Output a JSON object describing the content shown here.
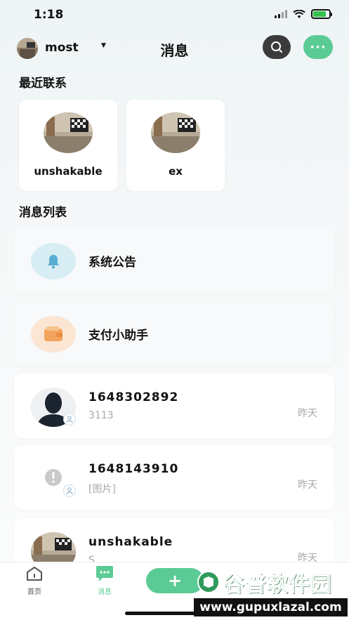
{
  "status_bar": {
    "time": "1:18"
  },
  "header": {
    "username": "most",
    "title": "消息"
  },
  "recent": {
    "section_title": "最近联系",
    "contacts": [
      {
        "name": "unshakable"
      },
      {
        "name": "ex"
      }
    ]
  },
  "messages": {
    "section_title": "消息列表",
    "system_notice": {
      "title": "系统公告"
    },
    "payment_helper": {
      "title": "支付小助手"
    },
    "items": [
      {
        "name": "1648302892",
        "preview": "3113",
        "time": "昨天"
      },
      {
        "name": "1648143910",
        "preview": "[图片]",
        "time": "昨天"
      },
      {
        "name": "unshakable",
        "preview": "S",
        "time": "昨天"
      }
    ]
  },
  "tabbar": {
    "home_label": "首页",
    "messages_label": "消息",
    "add_label": "+"
  },
  "watermark": {
    "main": "谷普软件园",
    "url": "www.gupuxlazal.com"
  },
  "colors": {
    "accent_green": "#5bcb95",
    "bell_bg": "#d7edf3",
    "wallet_bg": "#fbe5d3"
  },
  "icons": {
    "search": "search-icon",
    "more": "more-dots-icon",
    "bell": "bell-icon",
    "wallet": "wallet-icon",
    "group": "group-icon",
    "home": "home-icon",
    "chat": "chat-icon"
  }
}
